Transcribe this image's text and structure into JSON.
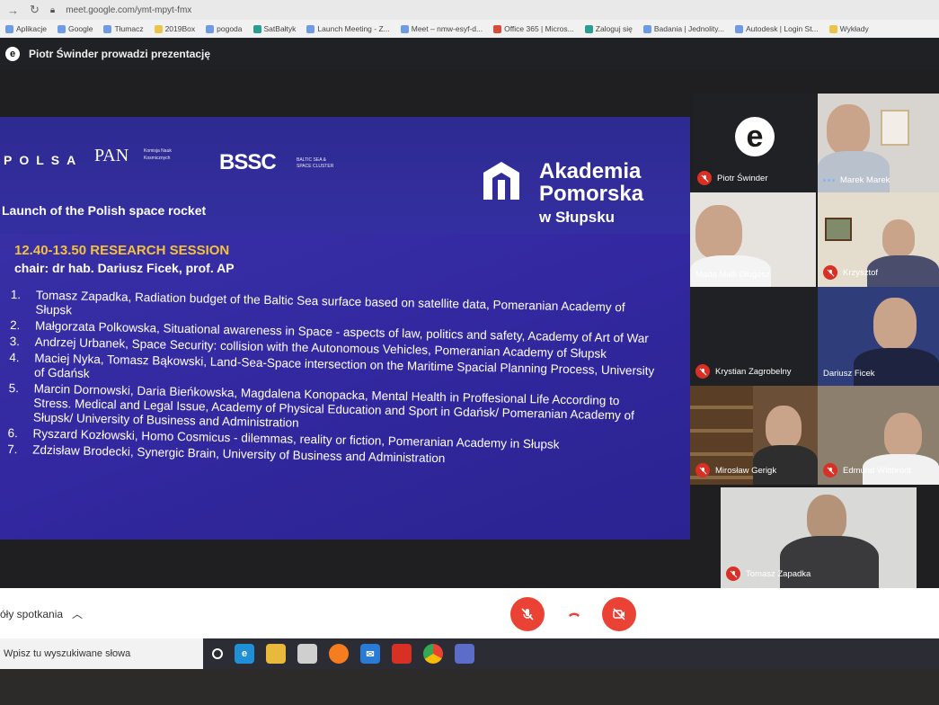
{
  "browser": {
    "url": "meet.google.com/ymt-mpyt-fmx",
    "bookmarks": [
      "Aplikacje",
      "Google",
      "Tłumacz",
      "2019Box",
      "pogoda",
      "SatBałtyk",
      "Launch Meeting - Z...",
      "Meet – nmw-esyf-d...",
      "Office 365 | Micros...",
      "Zaloguj się",
      "Badania | Jednolity...",
      "Autodesk | Login St...",
      "Wykłady"
    ]
  },
  "meet": {
    "presenter_text": "Piotr Świnder prowadzi prezentację",
    "meeting_details_label": "óły spotkania"
  },
  "slide": {
    "logo_polsa": "POLSA",
    "logo_pan": "PAN",
    "logo_pan_sub": "Komisja Nauk Kosmicznych",
    "logo_bssc": "BSSC",
    "logo_bssc_sub": "BALTIC SEA & SPACE CLUSTER",
    "akademia_line1": "Akademia",
    "akademia_line2": "Pomorska",
    "akademia_line3": "w Słupsku",
    "subtitle": "Launch of the Polish space rocket",
    "session_time": "12.40-13.50  RESEARCH SESSION",
    "session_chair": "chair: dr hab. Dariusz Ficek, prof. AP",
    "talks": [
      {
        "n": "1.",
        "text": "Tomasz Zapadka, Radiation budget of the Baltic Sea surface based on satellite data, Pomeranian Academy of Słupsk"
      },
      {
        "n": "2.",
        "text": "Małgorzata Polkowska, Situational awareness in Space - aspects of law, politics and safety, Academy of Art of War"
      },
      {
        "n": "3.",
        "text": "Andrzej Urbanek, Space Security: collision with the Autonomous Vehicles, Pomeranian Academy of Słupsk"
      },
      {
        "n": "4.",
        "text": "Maciej Nyka, Tomasz Bąkowski, Land-Sea-Space intersection on the Maritime Spacial Planning Process, University of Gdańsk"
      },
      {
        "n": "5.",
        "text": "Marcin Dornowski, Daria Bieńkowska, Magdalena Konopacka, Mental Health in Proffesional Life According to Stress. Medical and Legal Issue, Academy of Physical Education and Sport in Gdańsk/ Pomeranian Academy of Słupsk/ University of Business and Administration"
      },
      {
        "n": "6.",
        "text": "Ryszard Kozłowski, Homo Cosmicus - dilemmas, reality or fiction, Pomeranian Academy in Słupsk"
      },
      {
        "n": "7.",
        "text": "Zdzisław Brodecki, Synergic Brain, University of Business and Administration"
      }
    ]
  },
  "participants": {
    "piotr": "Piotr Świnder",
    "marek": "Marek Marek",
    "mada": "Mada Malli Długosz",
    "krzysztof": "Krzysztof",
    "krystian": "Krystian Zagrobelny",
    "dariusz": "Dariusz Ficek",
    "miroslaw": "Mirosław Gerigk",
    "edmund": "Edmund Wittbrodt",
    "tomasz": "Tomasz Zapadka"
  },
  "taskbar": {
    "search_placeholder": "Wpisz tu wyszukiwane słowa"
  },
  "colors": {
    "slide_bg": "#3a33a8",
    "session_accent": "#f3c13a",
    "mute_red": "#ea4335"
  }
}
